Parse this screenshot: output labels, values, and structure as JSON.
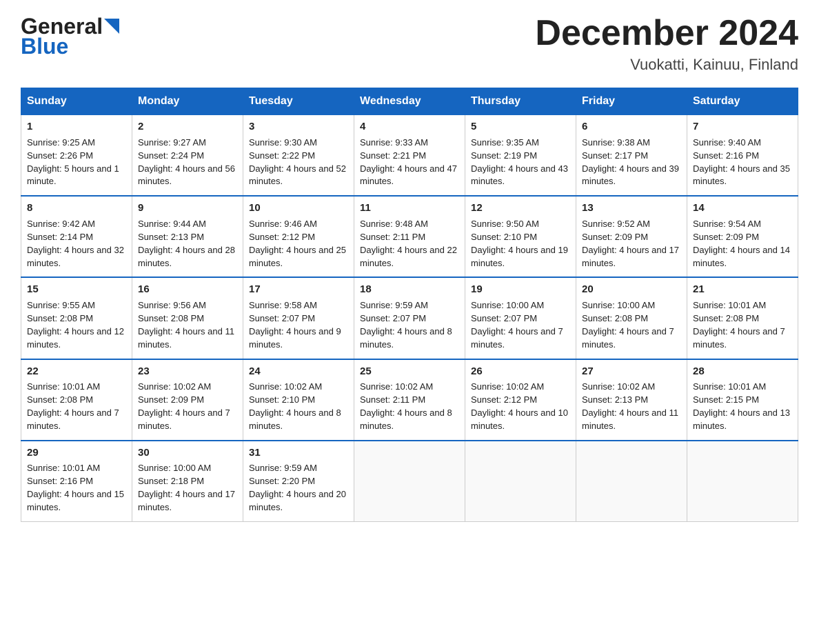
{
  "header": {
    "logo_line1": "General",
    "logo_line2": "Blue",
    "month_year": "December 2024",
    "location": "Vuokatti, Kainuu, Finland"
  },
  "columns": [
    "Sunday",
    "Monday",
    "Tuesday",
    "Wednesday",
    "Thursday",
    "Friday",
    "Saturday"
  ],
  "weeks": [
    [
      {
        "day": "1",
        "sunrise": "9:25 AM",
        "sunset": "2:26 PM",
        "daylight": "5 hours and 1 minute."
      },
      {
        "day": "2",
        "sunrise": "9:27 AM",
        "sunset": "2:24 PM",
        "daylight": "4 hours and 56 minutes."
      },
      {
        "day": "3",
        "sunrise": "9:30 AM",
        "sunset": "2:22 PM",
        "daylight": "4 hours and 52 minutes."
      },
      {
        "day": "4",
        "sunrise": "9:33 AM",
        "sunset": "2:21 PM",
        "daylight": "4 hours and 47 minutes."
      },
      {
        "day": "5",
        "sunrise": "9:35 AM",
        "sunset": "2:19 PM",
        "daylight": "4 hours and 43 minutes."
      },
      {
        "day": "6",
        "sunrise": "9:38 AM",
        "sunset": "2:17 PM",
        "daylight": "4 hours and 39 minutes."
      },
      {
        "day": "7",
        "sunrise": "9:40 AM",
        "sunset": "2:16 PM",
        "daylight": "4 hours and 35 minutes."
      }
    ],
    [
      {
        "day": "8",
        "sunrise": "9:42 AM",
        "sunset": "2:14 PM",
        "daylight": "4 hours and 32 minutes."
      },
      {
        "day": "9",
        "sunrise": "9:44 AM",
        "sunset": "2:13 PM",
        "daylight": "4 hours and 28 minutes."
      },
      {
        "day": "10",
        "sunrise": "9:46 AM",
        "sunset": "2:12 PM",
        "daylight": "4 hours and 25 minutes."
      },
      {
        "day": "11",
        "sunrise": "9:48 AM",
        "sunset": "2:11 PM",
        "daylight": "4 hours and 22 minutes."
      },
      {
        "day": "12",
        "sunrise": "9:50 AM",
        "sunset": "2:10 PM",
        "daylight": "4 hours and 19 minutes."
      },
      {
        "day": "13",
        "sunrise": "9:52 AM",
        "sunset": "2:09 PM",
        "daylight": "4 hours and 17 minutes."
      },
      {
        "day": "14",
        "sunrise": "9:54 AM",
        "sunset": "2:09 PM",
        "daylight": "4 hours and 14 minutes."
      }
    ],
    [
      {
        "day": "15",
        "sunrise": "9:55 AM",
        "sunset": "2:08 PM",
        "daylight": "4 hours and 12 minutes."
      },
      {
        "day": "16",
        "sunrise": "9:56 AM",
        "sunset": "2:08 PM",
        "daylight": "4 hours and 11 minutes."
      },
      {
        "day": "17",
        "sunrise": "9:58 AM",
        "sunset": "2:07 PM",
        "daylight": "4 hours and 9 minutes."
      },
      {
        "day": "18",
        "sunrise": "9:59 AM",
        "sunset": "2:07 PM",
        "daylight": "4 hours and 8 minutes."
      },
      {
        "day": "19",
        "sunrise": "10:00 AM",
        "sunset": "2:07 PM",
        "daylight": "4 hours and 7 minutes."
      },
      {
        "day": "20",
        "sunrise": "10:00 AM",
        "sunset": "2:08 PM",
        "daylight": "4 hours and 7 minutes."
      },
      {
        "day": "21",
        "sunrise": "10:01 AM",
        "sunset": "2:08 PM",
        "daylight": "4 hours and 7 minutes."
      }
    ],
    [
      {
        "day": "22",
        "sunrise": "10:01 AM",
        "sunset": "2:08 PM",
        "daylight": "4 hours and 7 minutes."
      },
      {
        "day": "23",
        "sunrise": "10:02 AM",
        "sunset": "2:09 PM",
        "daylight": "4 hours and 7 minutes."
      },
      {
        "day": "24",
        "sunrise": "10:02 AM",
        "sunset": "2:10 PM",
        "daylight": "4 hours and 8 minutes."
      },
      {
        "day": "25",
        "sunrise": "10:02 AM",
        "sunset": "2:11 PM",
        "daylight": "4 hours and 8 minutes."
      },
      {
        "day": "26",
        "sunrise": "10:02 AM",
        "sunset": "2:12 PM",
        "daylight": "4 hours and 10 minutes."
      },
      {
        "day": "27",
        "sunrise": "10:02 AM",
        "sunset": "2:13 PM",
        "daylight": "4 hours and 11 minutes."
      },
      {
        "day": "28",
        "sunrise": "10:01 AM",
        "sunset": "2:15 PM",
        "daylight": "4 hours and 13 minutes."
      }
    ],
    [
      {
        "day": "29",
        "sunrise": "10:01 AM",
        "sunset": "2:16 PM",
        "daylight": "4 hours and 15 minutes."
      },
      {
        "day": "30",
        "sunrise": "10:00 AM",
        "sunset": "2:18 PM",
        "daylight": "4 hours and 17 minutes."
      },
      {
        "day": "31",
        "sunrise": "9:59 AM",
        "sunset": "2:20 PM",
        "daylight": "4 hours and 20 minutes."
      },
      null,
      null,
      null,
      null
    ]
  ]
}
